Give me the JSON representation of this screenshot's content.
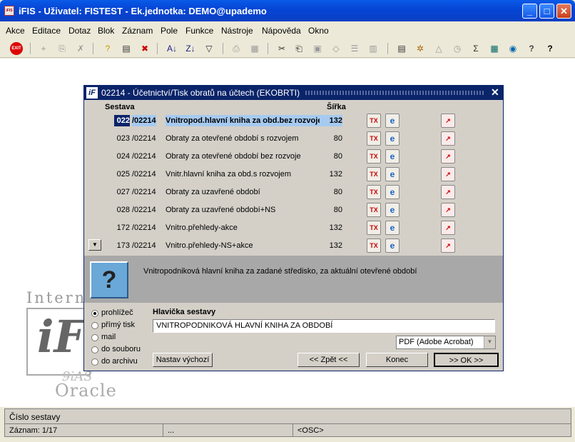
{
  "window": {
    "title": "iFIS - Uživatel: FISTEST - Ek.jednotka: DEMO@upademo",
    "icon_text": "iFIS",
    "min": "_",
    "max": "□",
    "close": "✕"
  },
  "menu": [
    "Akce",
    "Editace",
    "Dotaz",
    "Blok",
    "Záznam",
    "Pole",
    "Funkce",
    "Nástroje",
    "Nápověda",
    "Okno"
  ],
  "toolbar": {
    "exit_label": "EXIT"
  },
  "logo": {
    "intern": "Interne",
    "ifs": "iF",
    "ias": "9iAS",
    "oracle": "Oracle"
  },
  "dialog": {
    "title": "02214 - Účetnictví/Tisk obratů na účtech (EKOBRTI)",
    "close": "✕",
    "col_sestava": "Sestava",
    "col_sirka": "Šířka",
    "rows": [
      {
        "num": "022",
        "code": "/02214",
        "name": "Vnitropod.hlavní kniha za obd.bez rozvoje",
        "width": "132",
        "selected": true
      },
      {
        "num": "023",
        "code": "/02214",
        "name": "Obraty za otevřené období s rozvojem",
        "width": "80"
      },
      {
        "num": "024",
        "code": "/02214",
        "name": "Obraty za otevřené období bez rozvoje",
        "width": "80"
      },
      {
        "num": "025",
        "code": "/02214",
        "name": "Vnitr.hlavní kniha za obd.s rozvojem",
        "width": "132"
      },
      {
        "num": "027",
        "code": "/02214",
        "name": "Obraty za uzavřené období",
        "width": "80"
      },
      {
        "num": "028",
        "code": "/02214",
        "name": "Obraty za uzavřené období+NS",
        "width": "80"
      },
      {
        "num": "172",
        "code": "/02214",
        "name": "Vnitro.přehledy-akce",
        "width": "132"
      },
      {
        "num": "173",
        "code": "/02214",
        "name": "Vnitro.přehledy-NS+akce",
        "width": "132"
      }
    ],
    "icons": {
      "tx": "TX",
      "ie": "e",
      "pdf": "↗"
    },
    "scroll_down": "▼",
    "description": "Vnitropodniková hlavní kniha za zadané středisko, za aktuální otevřené období",
    "printer_glyph": "?",
    "output_options": [
      "prohlížeč",
      "přímý tisk",
      "mail",
      "do souboru",
      "do archivu"
    ],
    "output_selected": 0,
    "hlavicka_label": "Hlavička sestavy",
    "hlavicka_value": "VNITROPODNIKOVÁ HLAVNÍ KNIHA ZA OBDOBÍ",
    "format": "PDF (Adobe Acrobat)",
    "format_arrow": "▼",
    "buttons": {
      "reset": "Nastav výchozí",
      "back": "<< Zpět <<",
      "end": "Konec",
      "ok": ">> OK >>"
    }
  },
  "status": {
    "line1": "Číslo sestavy",
    "record": "Záznam: 1/17",
    "ellipsis": "...",
    "osc": "<OSC>"
  }
}
